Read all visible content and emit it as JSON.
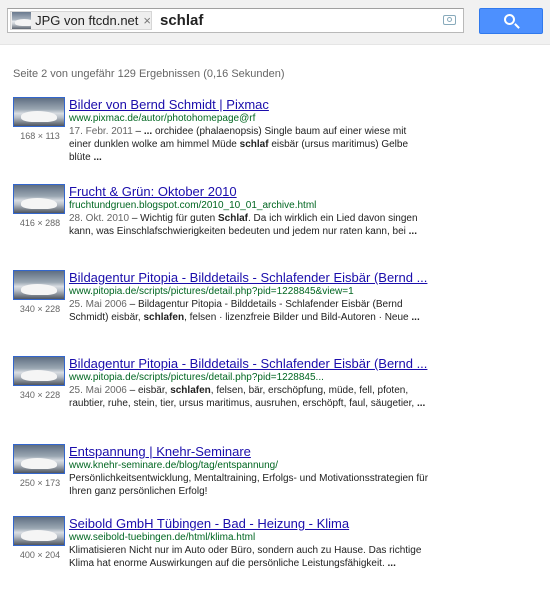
{
  "search": {
    "chip_label": "JPG von ftcdn.net",
    "chip_close": "×",
    "query": "schlaf"
  },
  "stats": "Seite 2 von ungefähr 129 Ergebnissen (0,16 Sekunden)",
  "results": [
    {
      "title": "Bilder von Bernd Schmidt | Pixmac",
      "url": "www.pixmac.de/autor/photohomepage@rf",
      "dims": "168 × 113",
      "date": "17. Febr. 2011",
      "snippet": [
        {
          "t": " – ",
          "b": false
        },
        {
          "t": "...",
          "b": true
        },
        {
          "t": " orchidee (phalaenopsis) Single baum auf einer wiese mit einer dunklen wolke am himmel Müde ",
          "b": false
        },
        {
          "t": "schlaf",
          "b": true
        },
        {
          "t": " eisbär (ursus maritimus) Gelbe blüte ",
          "b": false
        },
        {
          "t": "...",
          "b": true
        }
      ]
    },
    {
      "title": "Frucht & Grün: Oktober 2010",
      "url": "fruchtundgruen.blogspot.com/2010_10_01_archive.html",
      "dims": "416 × 288",
      "date": "28. Okt. 2010",
      "snippet": [
        {
          "t": " – Wichtig für guten ",
          "b": false
        },
        {
          "t": "Schlaf",
          "b": true
        },
        {
          "t": ". Da ich wirklich ein Lied davon singen kann, was Einschlafschwierigkeiten bedeuten und jedem nur raten kann, bei ",
          "b": false
        },
        {
          "t": "...",
          "b": true
        }
      ]
    },
    {
      "title": "Bildagentur Pitopia - Bilddetails - Schlafender Eisbär (Bernd ...",
      "url": "www.pitopia.de/scripts/pictures/detail.php?pid=1228845&view=1",
      "dims": "340 × 228",
      "date": "25. Mai 2006",
      "snippet": [
        {
          "t": " – Bildagentur Pitopia - Bilddetails - Schlafender Eisbär (Bernd Schmidt) eisbär, ",
          "b": false
        },
        {
          "t": "schlafen",
          "b": true
        },
        {
          "t": ", felsen · lizenzfreie Bilder und Bild-Autoren · Neue ",
          "b": false
        },
        {
          "t": "...",
          "b": true
        }
      ]
    },
    {
      "title": "Bildagentur Pitopia - Bilddetails - Schlafender Eisbär (Bernd ...",
      "url": "www.pitopia.de/scripts/pictures/detail.php?pid=1228845...",
      "dims": "340 × 228",
      "date": "25. Mai 2006",
      "snippet": [
        {
          "t": " – eisbär, ",
          "b": false
        },
        {
          "t": "schlafen",
          "b": true
        },
        {
          "t": ", felsen, bär, erschöpfung, müde, fell, pfoten, raubtier, ruhe, stein, tier, ursus maritimus, ausruhen, erschöpft, faul, säugetier, ",
          "b": false
        },
        {
          "t": "...",
          "b": true
        }
      ]
    },
    {
      "title": "Entspannung | Knehr-Seminare",
      "url": "www.knehr-seminare.de/blog/tag/entspannung/",
      "dims": "250 × 173",
      "date": "",
      "snippet": [
        {
          "t": "Persönlichkeitsentwicklung, Mentaltraining, Erfolgs- und Motivationsstrategien für Ihren ganz persönlichen Erfolg!",
          "b": false
        }
      ]
    },
    {
      "title": "Seibold GmbH Tübingen - Bad - Heizung - Klima",
      "url": "www.seibold-tuebingen.de/html/klima.html",
      "dims": "400 × 204",
      "date": "",
      "snippet": [
        {
          "t": "Klimatisieren Nicht nur im Auto oder Büro, sondern auch zu Hause. Das richtige Klima hat enorme Auswirkungen auf die persönliche Leistungsfähigkeit. ",
          "b": false
        },
        {
          "t": "...",
          "b": true
        }
      ]
    }
  ]
}
